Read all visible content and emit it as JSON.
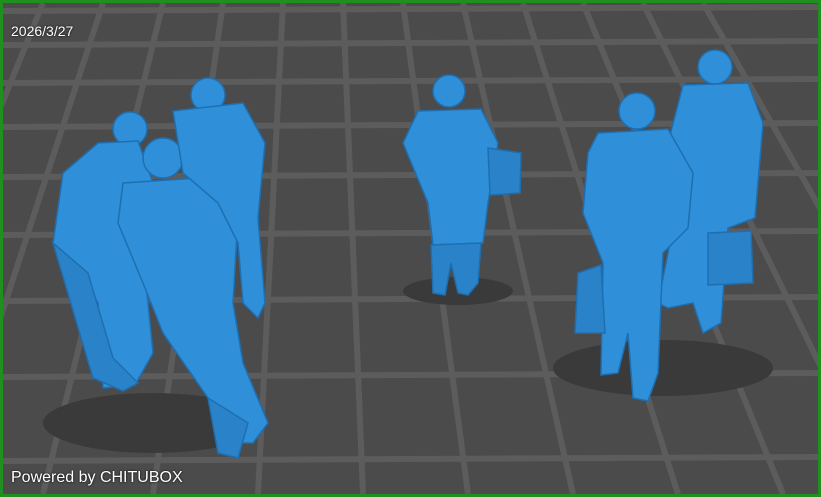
{
  "viewer": {
    "date": "2026/3/27",
    "powered_by": "Powered by CHITUBOX"
  },
  "scene": {
    "background_color": "#4a4a4a",
    "grid_line_color": "#5f5f5f",
    "model_color": "#2f8fd8",
    "model_shadow_color": "#1f6fb0",
    "border_color": "#1f8f1f",
    "models": [
      "figure-group-three-men",
      "figure-woman-with-handbag",
      "figure-two-men-with-bags"
    ]
  }
}
